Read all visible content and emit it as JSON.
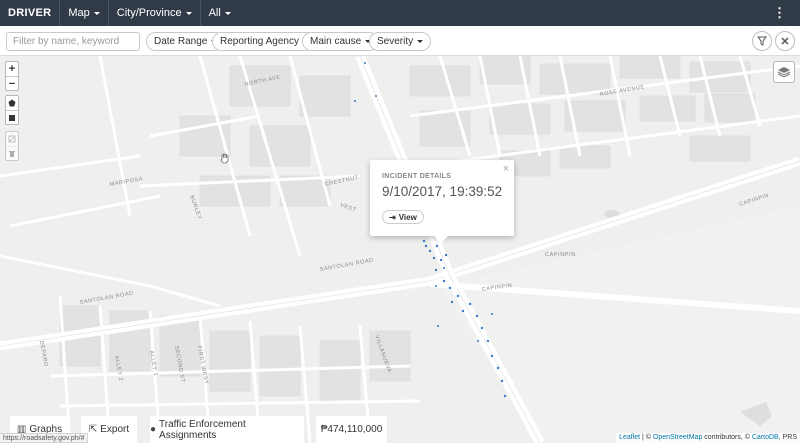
{
  "app": {
    "brand": "DRIVER",
    "nav": [
      {
        "label": "Map"
      },
      {
        "label": "City/Province"
      },
      {
        "label": "All"
      }
    ]
  },
  "filters": {
    "search_placeholder": "Filter by name, keyword",
    "dropdowns": [
      {
        "label": "Date Range"
      },
      {
        "label": "Reporting Agency"
      },
      {
        "label": "Main cause"
      },
      {
        "label": "Severity"
      }
    ]
  },
  "map": {
    "roads": [
      "NORTH AVE",
      "ROSE AVENUE",
      "BURLEY",
      "CHESTNUT",
      "MARIPOSA",
      "SANTOLAN ROAD",
      "CAPINPIN",
      "ALLEY 2",
      "ALLEY 1",
      "SECOND ST",
      "FIRST WEST",
      "DEPARO",
      "VILLANUEVA",
      "VEST"
    ],
    "accent_color": "#3b78c9"
  },
  "popup": {
    "title": "INCIDENT DETAILS",
    "datetime": "9/10/2017, 19:39:52",
    "view_label": "View",
    "close": "×"
  },
  "bottom": {
    "graphs_label": "Graphs",
    "export_label": "Export",
    "assignments_label": "Traffic Enforcement Assignments",
    "cost_label": "₱474,110,000"
  },
  "status_url": "https://roadsafety.gov.ph/#",
  "attribution": {
    "leaflet": "Leaflet",
    "sep1": " | © ",
    "osm": "OpenStreetMap",
    "mid": " contributors, © ",
    "carto": "CartoDB",
    "tail": ", PRS"
  }
}
